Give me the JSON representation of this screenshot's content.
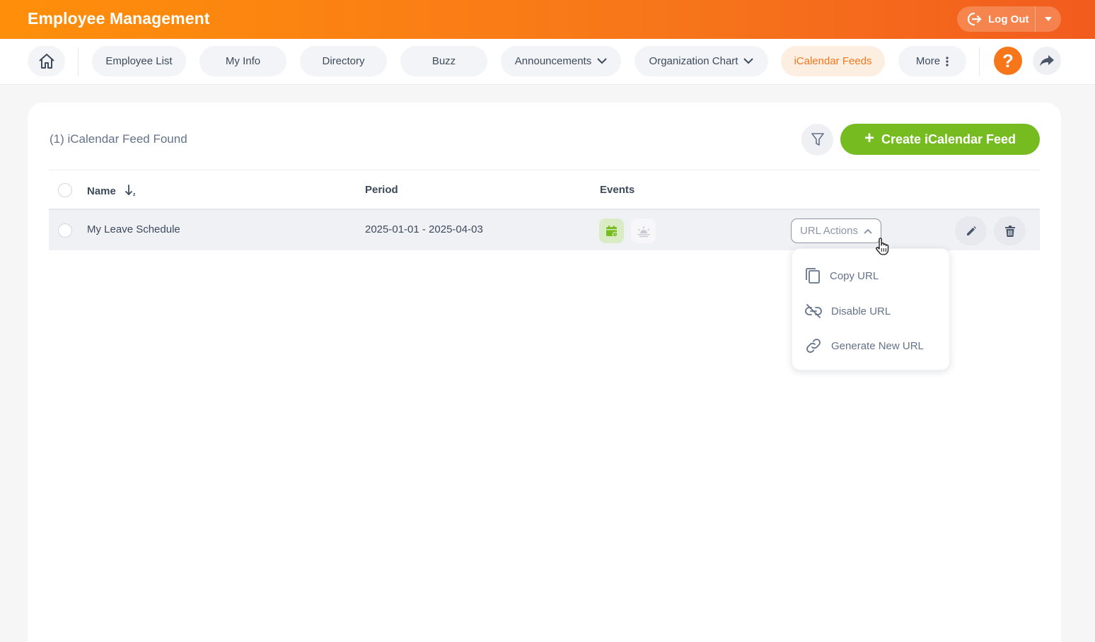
{
  "header": {
    "title": "Employee Management",
    "logout_label": "Log Out",
    "logout_icon": "logout-icon",
    "caret_icon": "caret-down-icon"
  },
  "nav": {
    "home_icon": "home-icon",
    "tabs": [
      {
        "label": "Employee List",
        "active": false
      },
      {
        "label": "My Info",
        "active": false
      },
      {
        "label": "Directory",
        "active": false
      },
      {
        "label": "Buzz",
        "active": false
      },
      {
        "label": "Announcements",
        "active": false,
        "has_dropdown": true
      },
      {
        "label": "Organization Chart",
        "active": false,
        "has_dropdown": true
      },
      {
        "label": "iCalendar Feeds",
        "active": true
      },
      {
        "label": "More",
        "active": false,
        "has_menu": true
      }
    ],
    "help_label": "?",
    "share_icon": "share-icon"
  },
  "content": {
    "records_count": "(1) iCalendar Feed Found",
    "create_button": "Create iCalendar Feed",
    "filter_icon": "filter-icon"
  },
  "table": {
    "columns": {
      "name": "Name",
      "period": "Period",
      "events": "Events"
    },
    "rows": [
      {
        "name": "My Leave Schedule",
        "period": "2025-01-01 - 2025-04-03",
        "events": [
          "calendar-leave-icon",
          "holiday-sun-icon"
        ],
        "url_actions_label": "URL Actions"
      }
    ]
  },
  "url_actions_menu": {
    "items": [
      {
        "label": "Copy URL",
        "icon": "copy-icon"
      },
      {
        "label": "Disable URL",
        "icon": "unlink-icon"
      },
      {
        "label": "Generate New URL",
        "icon": "link-icon"
      }
    ]
  },
  "colors": {
    "brand_orange": "#f7761a",
    "create_green": "#76bc21",
    "active_tab_bg": "#fdeee2"
  }
}
